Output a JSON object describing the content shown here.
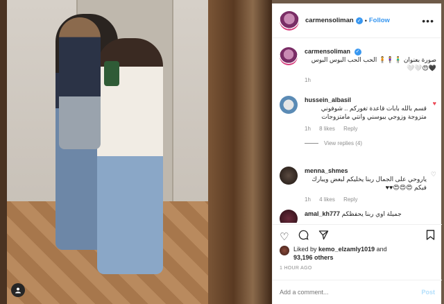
{
  "post": {
    "username": "carmensoliman",
    "follow_label": "Follow",
    "more_label": "•••"
  },
  "caption": {
    "username": "carmensoliman",
    "text": "صورة بعنوان 🧍‍♂️🧍‍♀️🧍 الحب الحب البوس البوس 🖤😍🤍🤍",
    "time": "1h"
  },
  "comments": [
    {
      "username": "hussein_albasil",
      "text": "قسم بالله بابات قاعدة تغوركم .. شوفوني متزوجة وزوجي يبوسني وانتي مامتزوجات",
      "time": "1h",
      "likes": "8 likes",
      "reply": "Reply",
      "view_replies": "View replies (4)"
    },
    {
      "username": "menna_shmes",
      "text": "ياروحي على الجمال ربنا يخليكم لبعض ويبارك فيكم 😍😍😍♥♥",
      "time": "1h",
      "likes": "4 likes",
      "reply": "Reply"
    },
    {
      "username": "amal_kh777",
      "text": "جميلة اوي ربنا يحفظكم"
    }
  ],
  "likes": {
    "prefix": "Liked by",
    "user": "kemo_elzamly1019",
    "and": "and",
    "others": "93,196 others"
  },
  "timestamp": "1 HOUR AGO",
  "add_comment": {
    "placeholder": "Add a comment...",
    "post_label": "Post"
  },
  "colors": {
    "accent": "#3897f0",
    "text": "#262626",
    "muted": "#8e8e8e",
    "like_red": "#ed4956"
  }
}
